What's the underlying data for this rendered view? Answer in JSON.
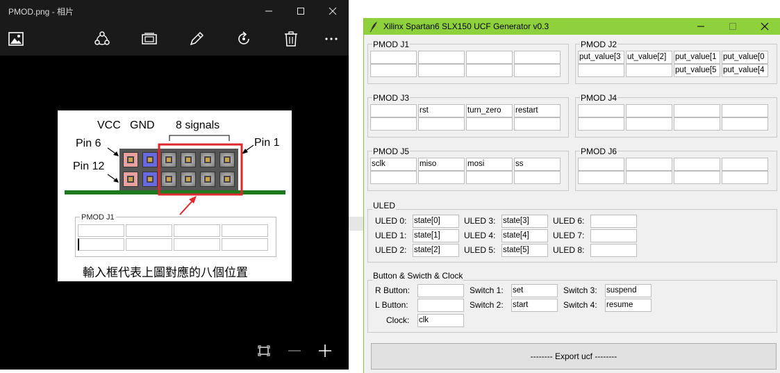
{
  "viewer": {
    "title": "PMOD.png - 相片",
    "photo": {
      "vcc": "VCC",
      "gnd": "GND",
      "signals": "8 signals",
      "pin6": "Pin 6",
      "pin1": "Pin 1",
      "pin12": "Pin 12",
      "mini_legend": "PMOD J1",
      "caption": "輸入框代表上圖對應的八個位置"
    },
    "toolbar_icons": [
      "image-icon",
      "share-icon",
      "slideshow-icon",
      "edit-icon",
      "rotate-icon",
      "delete-icon",
      "more-icon"
    ]
  },
  "generator": {
    "title": "Xilinx Spartan6 SLX150 UCF Generator v0.3",
    "pmods": [
      {
        "legend": "PMOD J1",
        "top": [
          "",
          "",
          "",
          ""
        ],
        "bottom": [
          "",
          "",
          "",
          ""
        ]
      },
      {
        "legend": "PMOD J2",
        "top": [
          "put_value[3",
          "ut_value[2]",
          "put_value[1",
          "put_value[0"
        ],
        "bottom": [
          "",
          "",
          "put_value[5",
          "put_value[4"
        ]
      },
      {
        "legend": "PMOD J3",
        "top": [
          "",
          "rst",
          "turn_zero",
          "restart"
        ],
        "bottom": [
          "",
          "",
          "",
          ""
        ]
      },
      {
        "legend": "PMOD J4",
        "top": [
          "",
          "",
          "",
          ""
        ],
        "bottom": [
          "",
          "",
          "",
          ""
        ]
      },
      {
        "legend": "PMOD J5",
        "top": [
          "sclk",
          "miso",
          "mosi",
          "ss"
        ],
        "bottom": [
          "",
          "",
          "",
          ""
        ]
      },
      {
        "legend": "PMOD J6",
        "top": [
          "",
          "",
          "",
          ""
        ],
        "bottom": [
          "",
          "",
          "",
          ""
        ]
      }
    ],
    "uled": {
      "legend": "ULED",
      "items": [
        {
          "label": "ULED 0:",
          "value": "state[0]"
        },
        {
          "label": "ULED 1:",
          "value": "state[1]"
        },
        {
          "label": "ULED 2:",
          "value": "state[2]"
        },
        {
          "label": "ULED 3:",
          "value": "state[3]"
        },
        {
          "label": "ULED 4:",
          "value": "state[4]"
        },
        {
          "label": "ULED 5:",
          "value": "state[5]"
        },
        {
          "label": "ULED 6:",
          "value": ""
        },
        {
          "label": "ULED 7:",
          "value": ""
        },
        {
          "label": "ULED 8:",
          "value": ""
        }
      ]
    },
    "buttons": {
      "legend": "Button & Swicth & Clock",
      "items": [
        {
          "label": "R Button:",
          "value": ""
        },
        {
          "label": "L Button:",
          "value": ""
        },
        {
          "label": "Clock:",
          "value": "clk"
        },
        {
          "label": "Switch 1:",
          "value": "set"
        },
        {
          "label": "Switch 2:",
          "value": "start"
        },
        {
          "label": "Switch 3:",
          "value": "suspend"
        },
        {
          "label": "Switch 4:",
          "value": "resume"
        }
      ]
    },
    "export_label": "-------- Export ucf --------"
  }
}
